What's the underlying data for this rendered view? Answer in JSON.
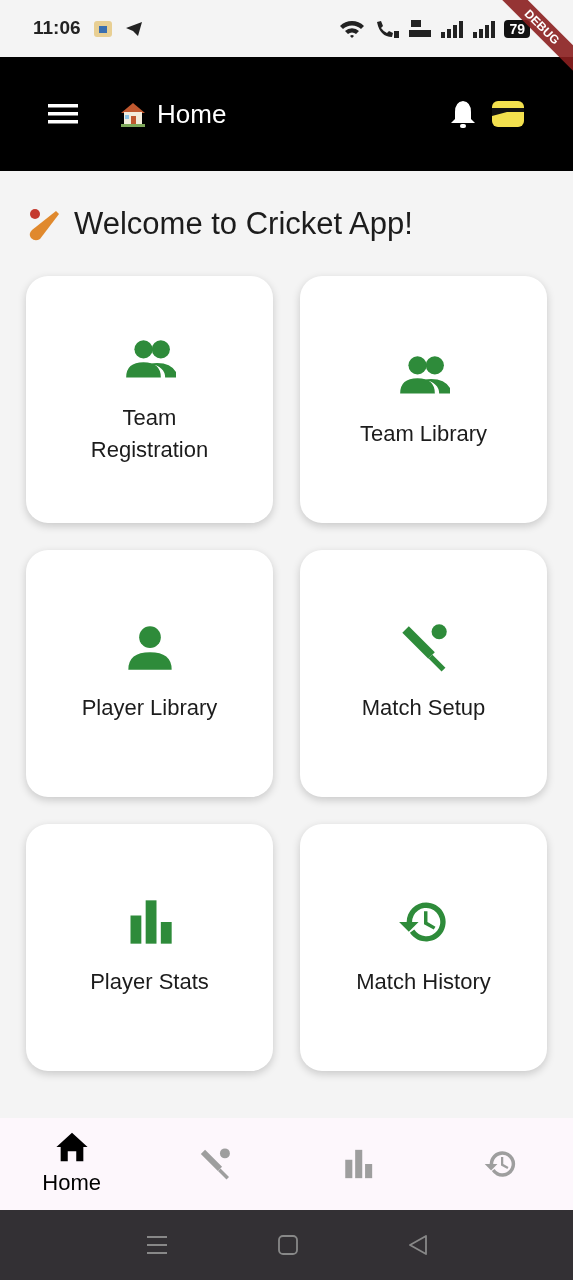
{
  "status_bar": {
    "time": "11:06",
    "battery": "79"
  },
  "debug_banner": "DEBUG",
  "app_bar": {
    "title": "Home"
  },
  "heading": "Welcome to Cricket App!",
  "cards": [
    {
      "label": "Team Registration",
      "kind": "group"
    },
    {
      "label": "Team Library",
      "kind": "group"
    },
    {
      "label": "Player Library",
      "kind": "person"
    },
    {
      "label": "Match Setup",
      "kind": "cricket"
    },
    {
      "label": "Player Stats",
      "kind": "chart"
    },
    {
      "label": "Match History",
      "kind": "history"
    }
  ],
  "bottom_nav": [
    {
      "label": "Home",
      "kind": "home",
      "selected": true
    },
    {
      "kind": "cricket",
      "selected": false
    },
    {
      "kind": "chart",
      "selected": false
    },
    {
      "kind": "history",
      "selected": false
    }
  ]
}
